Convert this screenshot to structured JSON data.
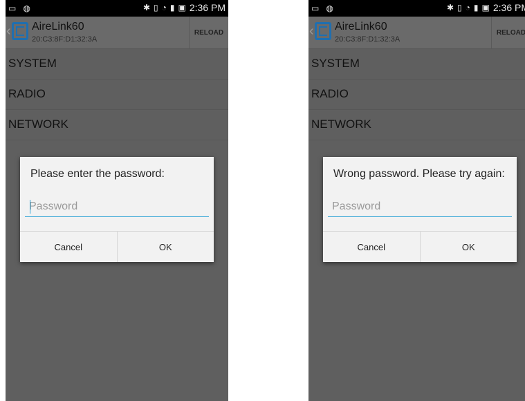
{
  "screens": [
    {
      "status": {
        "time": "2:36 PM"
      },
      "app": {
        "title": "AireLink60",
        "mac": "20:C3:8F:D1:32:3A",
        "reload_label": "RELOAD"
      },
      "menu": [
        "SYSTEM",
        "RADIO",
        "NETWORK"
      ],
      "dialog": {
        "message": "Please enter the password:",
        "placeholder": "Password",
        "cancel": "Cancel",
        "ok": "OK"
      }
    },
    {
      "status": {
        "time": "2:36 PM"
      },
      "app": {
        "title": "AireLink60",
        "mac": "20:C3:8F:D1:32:3A",
        "reload_label": "RELOAD"
      },
      "menu": [
        "SYSTEM",
        "RADIO",
        "NETWORK"
      ],
      "dialog": {
        "message": "Wrong password. Please try again:",
        "placeholder": "Password",
        "cancel": "Cancel",
        "ok": "OK"
      }
    }
  ],
  "colors": {
    "accent": "#2ea3d6",
    "logo": "#1f6fb0",
    "dim_background": "#5f5f5f"
  }
}
